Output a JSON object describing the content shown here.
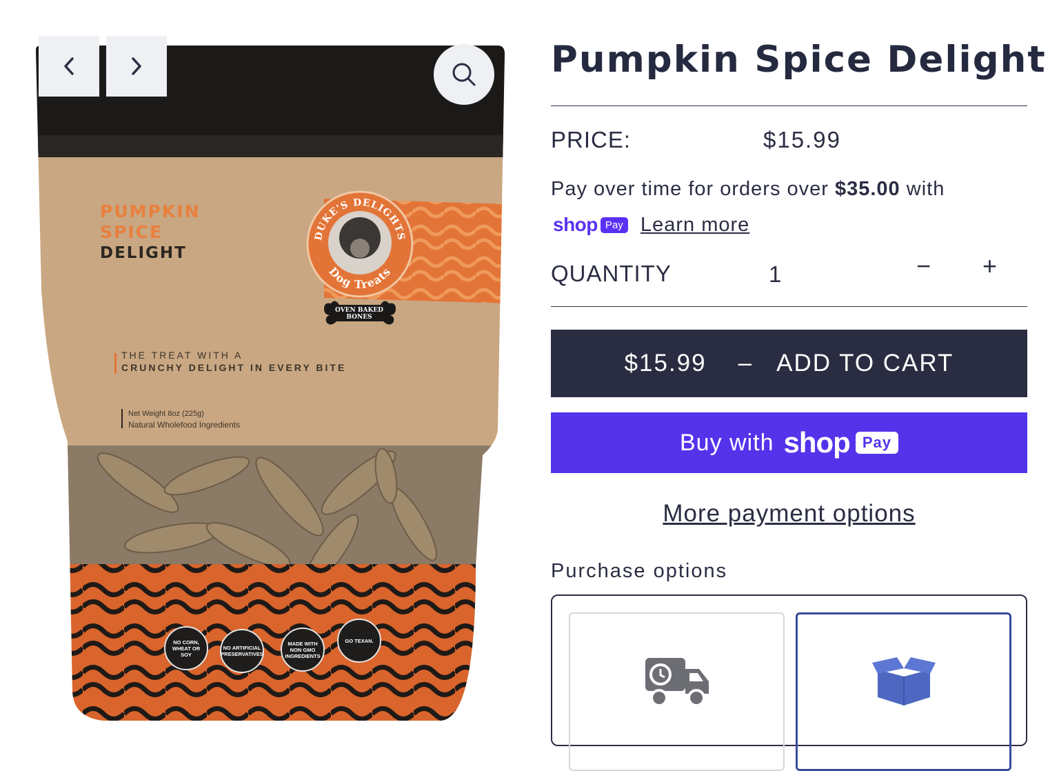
{
  "gallery": {
    "prev_icon": "chevron-left-icon",
    "next_icon": "chevron-right-icon",
    "zoom_icon": "search-icon",
    "package": {
      "title_line1": "PUMPKIN",
      "title_line2": "SPICE",
      "title_line3": "DELIGHT",
      "brand_top": "DUKE'S DELIGHTS",
      "brand_bottom": "Dog Treats",
      "bone_label": "OVEN BAKED BONES",
      "tagline_line1": "THE TREAT WITH A",
      "tagline_line2": "CRUNCHY DELIGHT IN EVERY BITE",
      "net_weight": "Net Weight 8oz (225g)",
      "ingredients": "Natural Wholefood Ingredients",
      "badges": [
        "NO CORN, WHEAT OR SOY",
        "NO ARTIFICIAL PRESERVATIVES",
        "MADE WITH NON GMO INGREDIENTS",
        "GO TEXAN."
      ]
    }
  },
  "product": {
    "title": "Pumpkin Spice Delight",
    "price_label": "PRICE:",
    "price": "$15.99",
    "installments_prefix": "Pay over time for orders over ",
    "installments_amount": "$35.00",
    "installments_suffix": " with",
    "shop_word": "shop",
    "pay_word": "Pay",
    "learn_more": "Learn more",
    "quantity_label": "QUANTITY",
    "quantity": "1",
    "minus": "−",
    "plus": "+",
    "add_to_cart_price": "$15.99",
    "add_to_cart_sep": "–",
    "add_to_cart_label": "ADD TO CART",
    "buy_with": "Buy with",
    "more_payment_options": "More payment options",
    "purchase_options_label": "Purchase options",
    "option_icons": [
      "delivery-truck-icon",
      "box-icon"
    ]
  },
  "colors": {
    "primary": "#2a2d42",
    "shop_pay": "#5433eb",
    "selected_border": "#3a4b9c",
    "pouch_orange": "#e8803e"
  }
}
